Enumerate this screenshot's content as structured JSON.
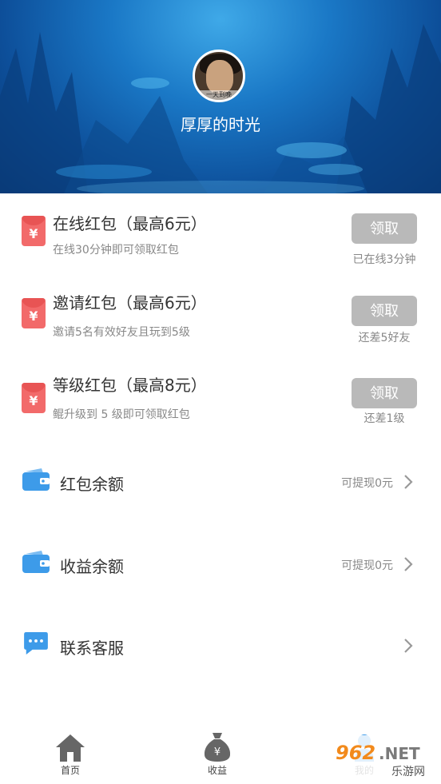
{
  "profile": {
    "username": "厚厚的时光",
    "avatar_caption": "一天到晚"
  },
  "red_packets": [
    {
      "title": "在线红包（最高6元）",
      "subtitle": "在线30分钟即可领取红包",
      "button": "领取",
      "status": "已在线3分钟"
    },
    {
      "title": "邀请红包（最高6元）",
      "subtitle": "邀请5名有效好友且玩到5级",
      "button": "领取",
      "status": "还差5好友"
    },
    {
      "title": "等级红包（最高8元）",
      "subtitle": "鲲升级到 5 级即可领取红包",
      "button": "领取",
      "status": "还差1级"
    }
  ],
  "menu": [
    {
      "label": "红包余额",
      "right": "可提现0元",
      "icon": "wallet-icon"
    },
    {
      "label": "收益余额",
      "right": "可提现0元",
      "icon": "wallet-icon"
    },
    {
      "label": "联系客服",
      "right": "",
      "icon": "chat-bubble-icon"
    }
  ],
  "tabs": [
    {
      "label": "首页",
      "icon": "home-icon"
    },
    {
      "label": "收益",
      "icon": "money-bag-icon"
    },
    {
      "label": "我的",
      "icon": "user-icon"
    }
  ],
  "watermark": {
    "text": "962.NET",
    "subtext": "乐游网"
  },
  "colors": {
    "accent_red": "#f26a6a",
    "wallet_blue": "#3d9be9",
    "button_gray": "#b9b9b9"
  }
}
